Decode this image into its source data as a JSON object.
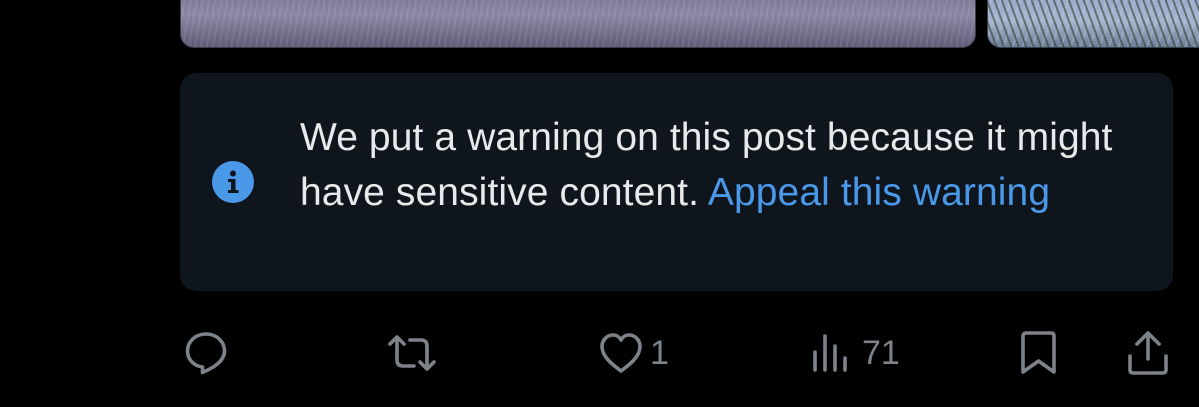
{
  "warning": {
    "message": "We put a warning on this post because it might have sensitive content.",
    "appeal_link": "Appeal this warning",
    "icon": "info-icon"
  },
  "actions": {
    "reply": {
      "icon": "reply-icon"
    },
    "repost": {
      "icon": "repost-icon"
    },
    "like": {
      "icon": "heart-icon",
      "count": "1"
    },
    "views": {
      "icon": "views-chart-icon",
      "count": "71"
    },
    "bookmark": {
      "icon": "bookmark-icon"
    },
    "share": {
      "icon": "share-icon"
    }
  },
  "colors": {
    "background": "#000000",
    "card_background": "#0f151d",
    "text": "#e7e9ea",
    "link": "#4a98e8",
    "icon_gray": "#7d8389"
  }
}
